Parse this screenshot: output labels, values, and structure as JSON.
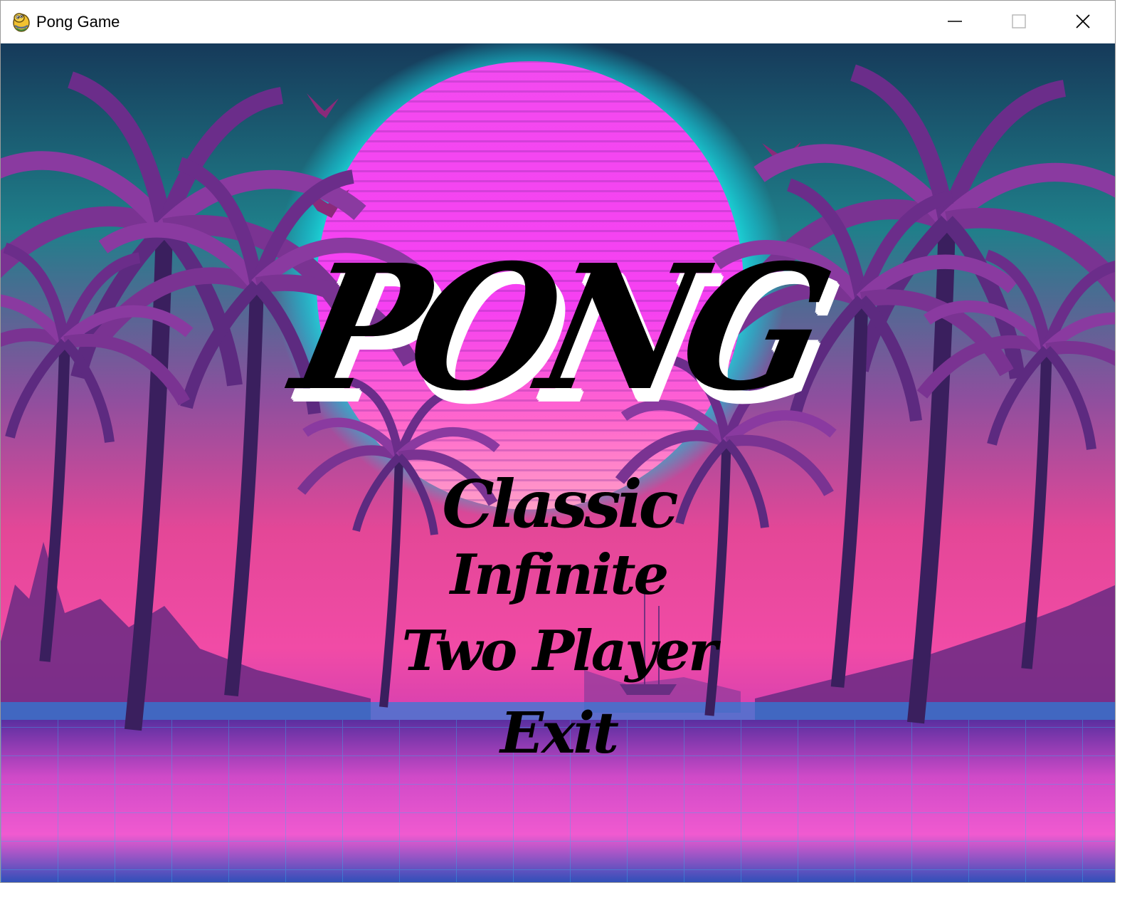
{
  "window": {
    "title": "Pong Game",
    "icon": "pygame-snake-icon"
  },
  "controls": {
    "minimize_icon": "minimize-icon",
    "maximize_icon": "maximize-icon",
    "close_icon": "close-icon"
  },
  "game": {
    "logo": "PONG",
    "menu": {
      "classic": "Classic",
      "infinite": "Infinite",
      "two_player": "Two Player",
      "exit": "Exit"
    },
    "colors": {
      "sun_pink": "#f53ff3",
      "sun_glow": "#17e8e6",
      "sky_teal": "#1f7f8a",
      "sky_pink": "#e8449c",
      "palm_dark": "#3b1f5c",
      "water_blue": "#2a6ad8",
      "text": "#000000",
      "text_shadow": "#ffffff"
    }
  }
}
